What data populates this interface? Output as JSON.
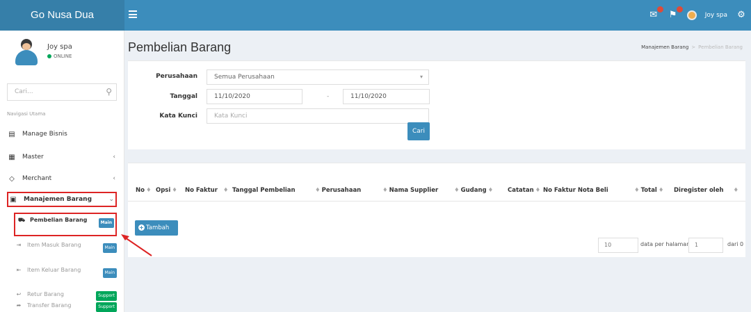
{
  "header": {
    "brand": "Go Nusa Dua",
    "user_name": "Joy spa"
  },
  "sidebar": {
    "user_name": "Joy spa",
    "status": "ONLINE",
    "search_placeholder": "Cari...",
    "nav_header": "Navigasi Utama",
    "items": [
      {
        "label": "Manage Bisnis",
        "icon": "book-icon"
      },
      {
        "label": "Master",
        "icon": "table-icon",
        "arrow": "‹"
      },
      {
        "label": "Merchant",
        "icon": "tag-icon",
        "arrow": "‹"
      },
      {
        "label": "Manajemen Barang",
        "icon": "box-icon",
        "arrow": "⌄"
      }
    ],
    "sub_items": [
      {
        "label": "Pembelian Barang",
        "badge": "Main",
        "icon": "cart-icon"
      },
      {
        "label": "Item Masuk Barang",
        "badge": "Main",
        "icon": "sign-in-icon"
      },
      {
        "label": "Item Keluar Barang",
        "badge": "Main",
        "icon": "sign-out-icon"
      },
      {
        "label": "Retur Barang",
        "badge": "Support",
        "icon": "return-icon"
      },
      {
        "label": "Transfer Barang",
        "badge": "Support",
        "icon": "share-icon"
      }
    ]
  },
  "page": {
    "title": "Pembelian Barang",
    "breadcrumb": [
      "Manajemen Barang",
      "Pembelian Barang"
    ]
  },
  "filter": {
    "perusahaan_label": "Perusahaan",
    "perusahaan_value": "Semua Perusahaan",
    "tanggal_label": "Tanggal",
    "date_from": "11/10/2020",
    "date_separator": "-",
    "date_to": "11/10/2020",
    "keyword_label": "Kata Kunci",
    "keyword_placeholder": "Kata Kunci",
    "search_button": "Cari"
  },
  "table": {
    "columns": [
      "No",
      "Opsi",
      "No Faktur",
      "Tanggal Pembelian",
      "Perusahaan",
      "Nama Supplier",
      "Gudang",
      "Catatan",
      "No Faktur Nota Beli",
      "Total",
      "Diregister oleh"
    ],
    "add_button": "Tambah",
    "per_page": "10",
    "per_page_label": "data per halaman",
    "page": "1",
    "of_label": "dari 0"
  },
  "colors": {
    "header": "#3c8dbc",
    "brand_bg": "#367fa9",
    "highlight": "#dd2424"
  }
}
